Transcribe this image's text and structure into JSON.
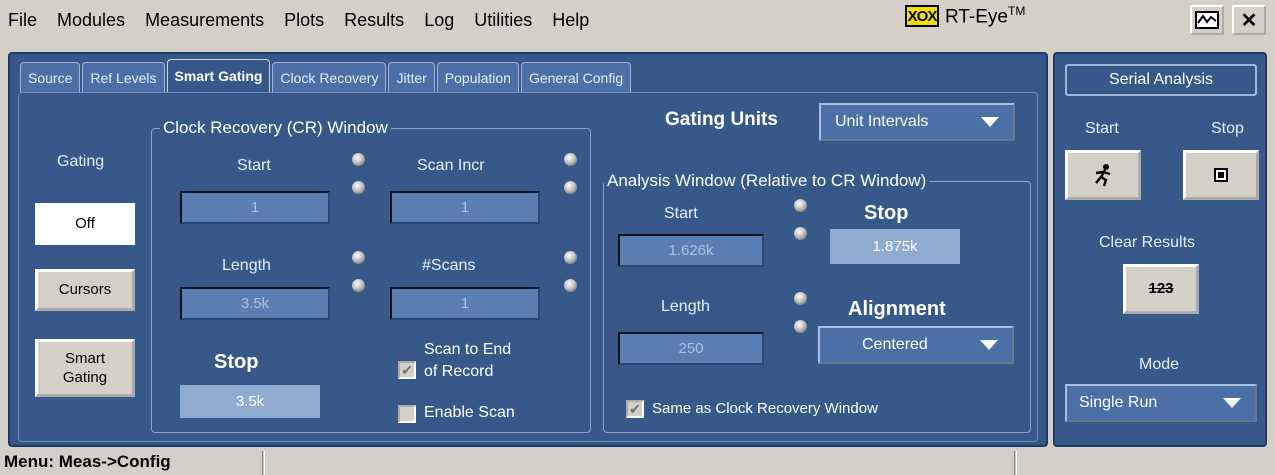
{
  "menubar": {
    "items": [
      "File",
      "Modules",
      "Measurements",
      "Plots",
      "Results",
      "Log",
      "Utilities",
      "Help"
    ],
    "brand_logo": "XOX",
    "brand_name": "RT-Eye",
    "brand_tm": "TM",
    "close_label": "✕"
  },
  "tabs": [
    "Source",
    "Ref Levels",
    "Smart Gating",
    "Clock Recovery",
    "Jitter",
    "Population",
    "General Config"
  ],
  "active_tab": "Smart Gating",
  "gating": {
    "label": "Gating",
    "off_label": "Off",
    "cursors_label": "Cursors",
    "smart_gating_label": "Smart\nGating"
  },
  "cr_window": {
    "title": "Clock Recovery (CR) Window",
    "start_label": "Start",
    "start_value": "1",
    "scan_incr_label": "Scan Incr",
    "scan_incr_value": "1",
    "length_label": "Length",
    "length_value": "3.5k",
    "scans_label": "#Scans",
    "scans_value": "1",
    "stop_label": "Stop",
    "stop_value": "3.5k",
    "scan_to_end_label": "Scan to End\nof Record",
    "scan_to_end_checked": true,
    "enable_scan_label": "Enable Scan",
    "enable_scan_checked": false
  },
  "gating_units": {
    "label": "Gating Units",
    "value": "Unit Intervals"
  },
  "analysis_window": {
    "title": "Analysis Window (Relative to CR Window)",
    "start_label": "Start",
    "start_value": "1.626k",
    "stop_label": "Stop",
    "stop_value": "1.875k",
    "length_label": "Length",
    "length_value": "250",
    "alignment_label": "Alignment",
    "alignment_value": "Centered",
    "same_as_cr_label": "Same as Clock Recovery Window",
    "same_as_cr_checked": true
  },
  "serial_analysis": {
    "title": "Serial Analysis",
    "start_label": "Start",
    "stop_label": "Stop",
    "clear_results_label": "Clear Results",
    "clear_icon_text": "123",
    "mode_label": "Mode",
    "mode_value": "Single Run"
  },
  "statusbar": {
    "menu_text": "Menu: Meas->Config"
  }
}
